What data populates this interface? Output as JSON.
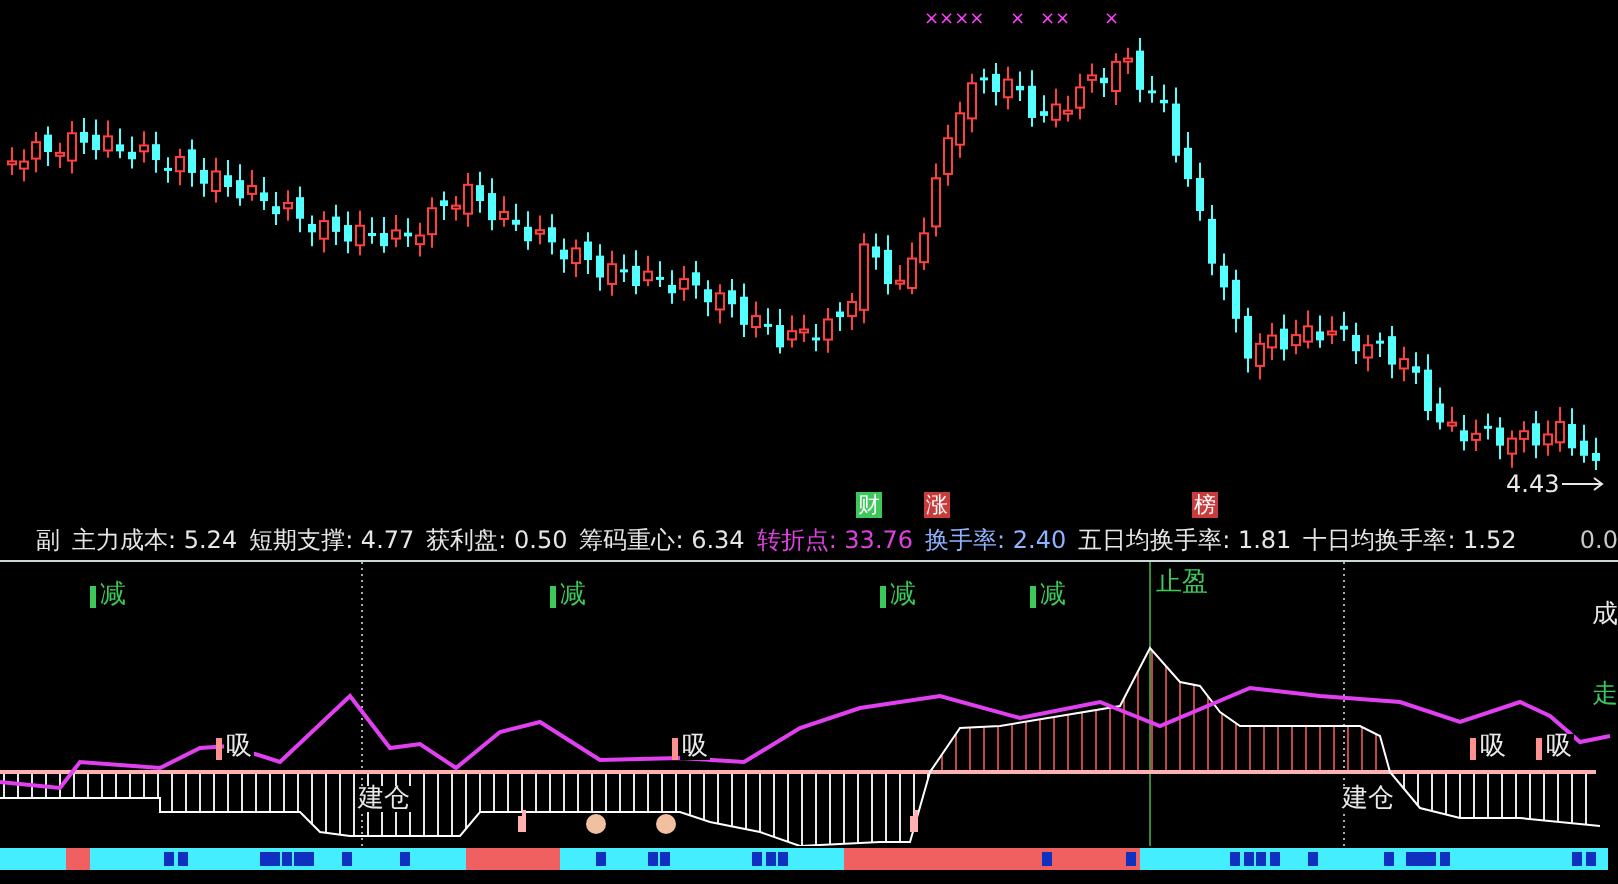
{
  "main_chart": {
    "top_marks": [
      "××××",
      "×",
      "××",
      "×"
    ],
    "event_tags": [
      {
        "text": "财",
        "color": "#3cc85a"
      },
      {
        "text": "涨",
        "color": "#c83c3c"
      },
      {
        "text": "榜",
        "color": "#c83c3c"
      }
    ],
    "low_label": "4.43"
  },
  "indicator_bar": {
    "items": [
      {
        "text": "副",
        "color": "#e6e6e6"
      },
      {
        "text": "主力成本: 5.24",
        "color": "#e6e6e6"
      },
      {
        "text": "短期支撑: 4.77",
        "color": "#e6e6e6"
      },
      {
        "text": "获利盘: 0.50",
        "color": "#e6e6e6"
      },
      {
        "text": "筹码重心: 6.34",
        "color": "#e6e6e6"
      },
      {
        "text": "转折点: 33.76",
        "color": "#e040e0"
      },
      {
        "text": "换手率: 2.40",
        "color": "#8fb4ff"
      },
      {
        "text": "五日均换手率: 1.81",
        "color": "#e6e6e6"
      },
      {
        "text": "十日均换手率: 1.52",
        "color": "#e6e6e6"
      }
    ],
    "right_value": "0.0"
  },
  "lower_panel": {
    "signals": [
      {
        "kind": "reduce",
        "text": "减"
      },
      {
        "kind": "reduce",
        "text": "减"
      },
      {
        "kind": "reduce",
        "text": "减"
      },
      {
        "kind": "reduce",
        "text": "减"
      },
      {
        "kind": "take-profit",
        "text": "止盈"
      },
      {
        "kind": "side",
        "text": "成"
      },
      {
        "kind": "side-green",
        "text": "走"
      },
      {
        "kind": "absorb",
        "text": "吸"
      },
      {
        "kind": "absorb",
        "text": "吸"
      },
      {
        "kind": "absorb",
        "text": "吸"
      },
      {
        "kind": "absorb",
        "text": "吸"
      },
      {
        "kind": "build",
        "text": "建仓"
      },
      {
        "kind": "build",
        "text": "建仓"
      }
    ]
  }
}
